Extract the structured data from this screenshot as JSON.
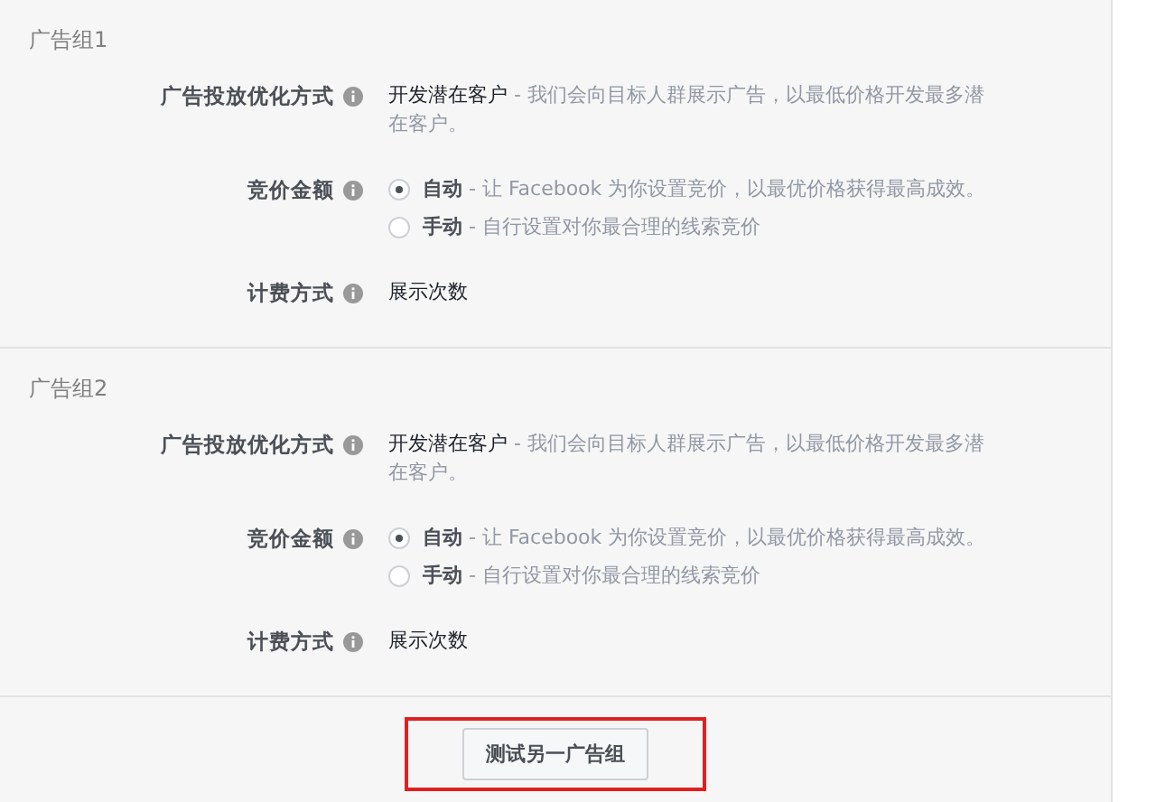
{
  "ad_groups": [
    {
      "title": "广告组1",
      "optimization": {
        "label": "广告投放优化方式",
        "value": "开发潜在客户",
        "description": " - 我们会向目标人群展示广告，以最低价格开发最多潜在客户。"
      },
      "bid": {
        "label": "竞价金额",
        "options": [
          {
            "label": "自动",
            "description": " - 让 Facebook 为你设置竞价，以最优价格获得最高成效。",
            "selected": true
          },
          {
            "label": "手动",
            "description": " - 自行设置对你最合理的线索竞价",
            "selected": false
          }
        ]
      },
      "billing": {
        "label": "计费方式",
        "value": "展示次数"
      }
    },
    {
      "title": "广告组2",
      "optimization": {
        "label": "广告投放优化方式",
        "value": "开发潜在客户",
        "description": " - 我们会向目标人群展示广告，以最低价格开发最多潜在客户。"
      },
      "bid": {
        "label": "竞价金额",
        "options": [
          {
            "label": "自动",
            "description": " - 让 Facebook 为你设置竞价，以最优价格获得最高成效。",
            "selected": true
          },
          {
            "label": "手动",
            "description": " - 自行设置对你最合理的线索竞价",
            "selected": false
          }
        ]
      },
      "billing": {
        "label": "计费方式",
        "value": "展示次数"
      }
    }
  ],
  "footer": {
    "button": "测试另一广告组",
    "highlighted": true
  }
}
